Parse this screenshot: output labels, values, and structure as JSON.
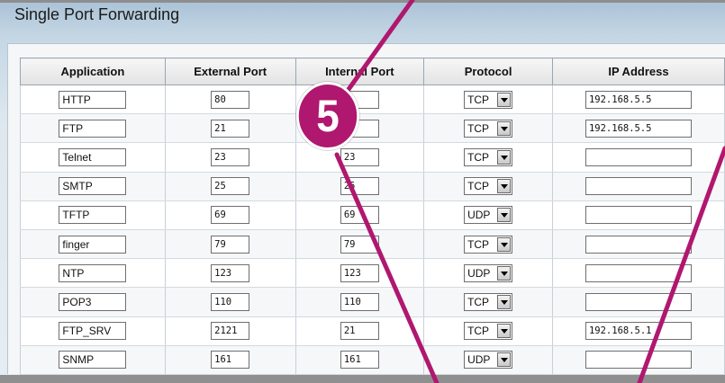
{
  "page": {
    "title": "Single Port Forwarding"
  },
  "table": {
    "headers": [
      "Application",
      "External Port",
      "Internal Port",
      "Protocol",
      "IP Address"
    ],
    "rows": [
      {
        "application": "HTTP",
        "external_port": "80",
        "internal_port": "",
        "protocol": "TCP",
        "ip_address": "192.168.5.5"
      },
      {
        "application": "FTP",
        "external_port": "21",
        "internal_port": "",
        "protocol": "TCP",
        "ip_address": "192.168.5.5"
      },
      {
        "application": "Telnet",
        "external_port": "23",
        "internal_port": "23",
        "protocol": "TCP",
        "ip_address": ""
      },
      {
        "application": "SMTP",
        "external_port": "25",
        "internal_port": "25",
        "protocol": "TCP",
        "ip_address": ""
      },
      {
        "application": "TFTP",
        "external_port": "69",
        "internal_port": "69",
        "protocol": "UDP",
        "ip_address": ""
      },
      {
        "application": "finger",
        "external_port": "79",
        "internal_port": "79",
        "protocol": "TCP",
        "ip_address": ""
      },
      {
        "application": "NTP",
        "external_port": "123",
        "internal_port": "123",
        "protocol": "UDP",
        "ip_address": ""
      },
      {
        "application": "POP3",
        "external_port": "110",
        "internal_port": "110",
        "protocol": "TCP",
        "ip_address": ""
      },
      {
        "application": "FTP_SRV",
        "external_port": "2121",
        "internal_port": "21",
        "protocol": "TCP",
        "ip_address": "192.168.5.1"
      },
      {
        "application": "SNMP",
        "external_port": "161",
        "internal_port": "161",
        "protocol": "UDP",
        "ip_address": ""
      }
    ]
  },
  "callout": {
    "step_number": "5",
    "color": "#b0176f"
  },
  "icons": {
    "dropdown": "chevron-down-icon"
  }
}
